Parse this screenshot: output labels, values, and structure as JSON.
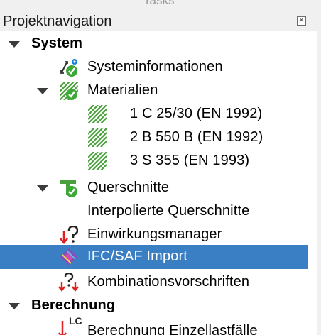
{
  "window": {
    "tab_title": "Tasks"
  },
  "panel": {
    "title": "Projektnavigation",
    "close_symbol": "×"
  },
  "tree": {
    "system": {
      "label": "System",
      "items": {
        "systeminformationen": "Systeminformationen",
        "materialien": {
          "label": "Materialien",
          "children": [
            "1 C 25/30 (EN 1992)",
            "2 B 550 B (EN 1992)",
            "3 S 355 (EN 1993)"
          ]
        },
        "querschnitte": "Querschnitte",
        "interpolierte": "Interpolierte Querschnitte",
        "einwirkungsmanager": "Einwirkungsmanager",
        "ifc_import": "IFC/SAF Import",
        "kombinationsvorschriften": "Kombinationsvorschriften"
      }
    },
    "berechnung": {
      "label": "Berechnung",
      "items": {
        "einzellastfaelle": "Berechnung Einzellastfälle",
        "lc_badge": "LC"
      }
    }
  },
  "colors": {
    "selection": "#3a7fc4",
    "check_green": "#3aa935",
    "hatch_green": "#4aa03c",
    "arrow_red": "#e02020"
  }
}
